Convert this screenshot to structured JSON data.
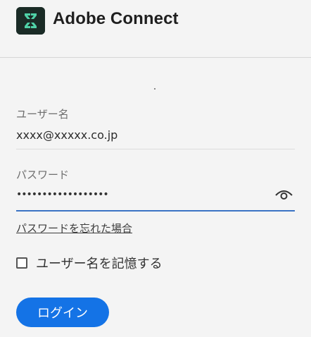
{
  "header": {
    "app_name": "Adobe Connect",
    "logo_icon": "adobe-connect-logo-icon"
  },
  "form": {
    "username_label": "ユーザー名",
    "username_value": "xxxx@xxxxx.co.jp",
    "password_label": "パスワード",
    "password_value": "••••••••••••••••••",
    "show_password_icon": "eye-icon",
    "forgot_password_link": "パスワードを忘れた場合",
    "remember_username_label": "ユーザー名を記憶する",
    "remember_username_checked": false,
    "login_button": "ログイン"
  },
  "colors": {
    "accent": "#1473e6",
    "logo_bg": "#1a2b26",
    "logo_mark": "#4fd1a7",
    "focus_underline": "#3b73c4"
  }
}
